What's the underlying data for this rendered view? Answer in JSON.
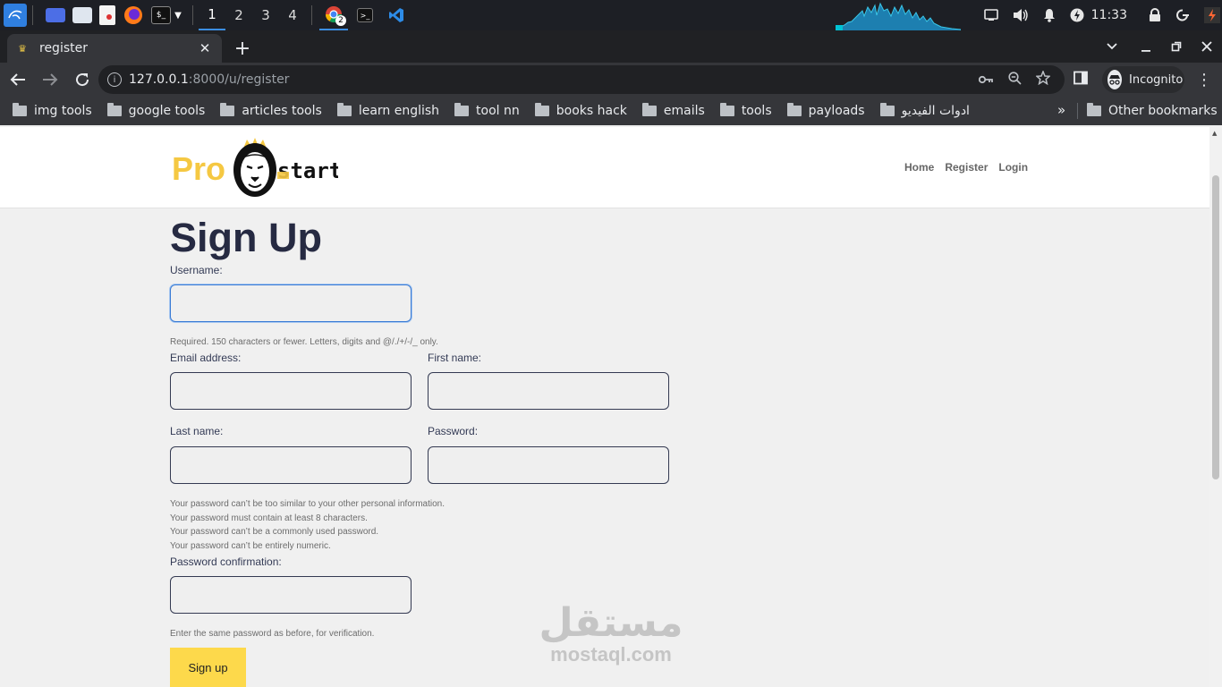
{
  "taskbar": {
    "workspaces": [
      "1",
      "2",
      "3",
      "4"
    ],
    "clock": "11:33",
    "chrome_badge": "2"
  },
  "browser": {
    "tab_title": "register",
    "url_host": "127.0.0.1",
    "url_rest": ":8000/u/register",
    "incognito_label": "Incognito",
    "bookmarks": [
      "img tools",
      "google tools",
      "articles tools",
      "learn english",
      "tool nn",
      "books hack",
      "emails",
      "tools",
      "payloads",
      "ادوات الفيديو"
    ],
    "other_bookmarks": "Other bookmarks"
  },
  "site": {
    "logo": {
      "part1": "Pro",
      "part2": "start"
    },
    "nav": [
      "Home",
      "Register",
      "Login"
    ]
  },
  "form": {
    "title": "Sign Up",
    "username_label": "Username:",
    "username_help": "Required. 150 characters or fewer. Letters, digits and @/./+/-/_ only.",
    "email_label": "Email address:",
    "first_name_label": "First name:",
    "last_name_label": "Last name:",
    "password_label": "Password:",
    "password_help": [
      "Your password can’t be too similar to your other personal information.",
      "Your password must contain at least 8 characters.",
      "Your password can’t be a commonly used password.",
      "Your password can’t be entirely numeric."
    ],
    "password_confirm_label": "Password confirmation:",
    "password_confirm_help": "Enter the same password as before, for verification.",
    "submit_label": "Sign up"
  },
  "watermark": {
    "arabic": "مستقل",
    "latin": "mostaql.com"
  },
  "colors": {
    "accent_yellow": "#fdd94b",
    "title": "#262a42",
    "focus_border": "#3a7bd5"
  }
}
